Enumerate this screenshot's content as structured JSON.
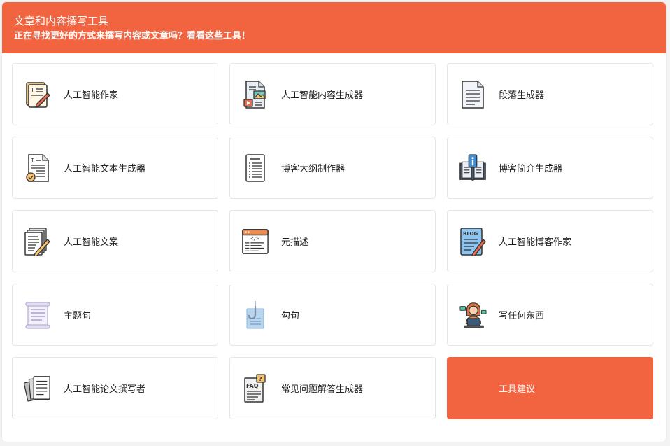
{
  "banner": {
    "title": "文章和内容撰写工具",
    "subtitle": "正在寻找更好的方式来撰写内容或文章吗？看看这些工具！"
  },
  "tools": [
    {
      "label": "人工智能作家",
      "icon": "writer-icon"
    },
    {
      "label": "人工智能内容生成器",
      "icon": "content-generator-icon"
    },
    {
      "label": "段落生成器",
      "icon": "paragraph-icon"
    },
    {
      "label": "人工智能文本生成器",
      "icon": "text-generator-icon"
    },
    {
      "label": "博客大纲制作器",
      "icon": "outline-icon"
    },
    {
      "label": "博客简介生成器",
      "icon": "intro-book-icon"
    },
    {
      "label": "人工智能文案",
      "icon": "copywriting-icon"
    },
    {
      "label": "元描述",
      "icon": "meta-code-icon"
    },
    {
      "label": "人工智能博客作家",
      "icon": "blog-icon"
    },
    {
      "label": "主题句",
      "icon": "scroll-icon"
    },
    {
      "label": "勾句",
      "icon": "hook-icon"
    },
    {
      "label": "写任何东西",
      "icon": "person-laptop-icon"
    },
    {
      "label": "人工智能论文撰写者",
      "icon": "papers-icon"
    },
    {
      "label": "常见问题解答生成器",
      "icon": "faq-icon"
    },
    {
      "label": "工具建议",
      "icon": ""
    }
  ],
  "colors": {
    "accent": "#f26440"
  }
}
